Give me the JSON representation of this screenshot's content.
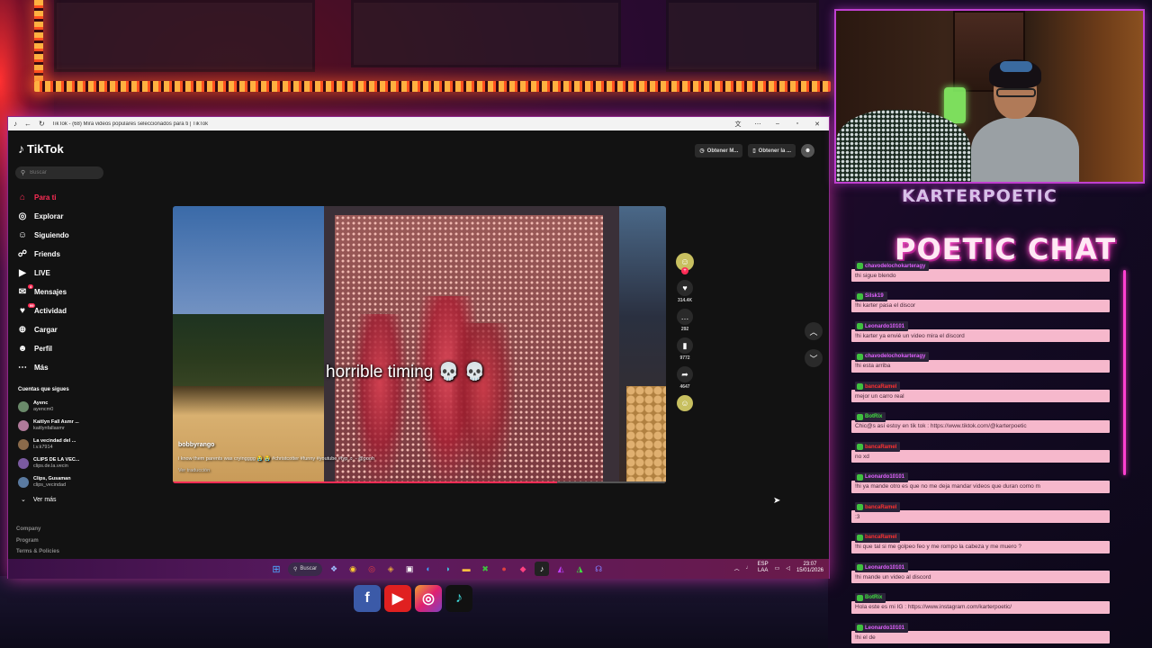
{
  "window": {
    "title": "TikTok - (68) Mira videos populares seleccionados para ti | TikTok"
  },
  "tiktok": {
    "logo": "TikTok",
    "search_placeholder": "Buscar",
    "nav": [
      {
        "label": "Para ti",
        "icon": "home-icon",
        "active": true
      },
      {
        "label": "Explorar",
        "icon": "compass-icon"
      },
      {
        "label": "Siguiendo",
        "icon": "following-icon"
      },
      {
        "label": "Friends",
        "icon": "friends-icon"
      },
      {
        "label": "LIVE",
        "icon": "live-icon"
      },
      {
        "label": "Mensajes",
        "icon": "messages-icon",
        "badge": "4"
      },
      {
        "label": "Actividad",
        "icon": "activity-icon",
        "badge": "99"
      },
      {
        "label": "Cargar",
        "icon": "upload-icon"
      },
      {
        "label": "Perfil",
        "icon": "profile-icon"
      },
      {
        "label": "Más",
        "icon": "more-icon"
      }
    ],
    "following_title": "Cuentas que sigues",
    "following": [
      {
        "name": "Ayenc",
        "handle": "ayencm0",
        "color": "#6a8a6a"
      },
      {
        "name": "Kaitlyn Fall Asmr ...",
        "handle": "kaitlynfallasmr",
        "color": "#b07a9a"
      },
      {
        "name": "La vecindad del ...",
        "handle": "l.v.k7914",
        "color": "#8a6a4a"
      },
      {
        "name": "CLIPS DE LA VEC...",
        "handle": "clips.de.la.vecin",
        "color": "#7a5aa0"
      },
      {
        "name": "Clips, Gusaman",
        "handle": "clips_vecindad",
        "color": "#5a7aa0"
      }
    ],
    "see_more": "Ver más",
    "footer": [
      "Company",
      "Program",
      "Terms & Policies"
    ],
    "top_buttons": [
      "Obtener M...",
      "Obtener la ..."
    ],
    "video": {
      "caption": "horrible timing",
      "author": "bobbyrango",
      "description": "i know them parents was cryingggg 😭 😭 #christcotter #funny #youtube #fyp ♬ - @pooh",
      "translate": "Ver traducción",
      "progress": 0.78
    },
    "actions": [
      {
        "icon": "heart-icon",
        "count": "314.4K"
      },
      {
        "icon": "comment-icon",
        "count": "292"
      },
      {
        "icon": "bookmark-icon",
        "count": "9772"
      },
      {
        "icon": "share-icon",
        "count": "4647"
      }
    ]
  },
  "taskbar": {
    "search_label": "Buscar",
    "lang_top": "ESP",
    "lang_bottom": "LAA",
    "time": "23:07",
    "date": "15/01/2026"
  },
  "stream": {
    "channel_name": "KARTERPOETIC",
    "chat_title": "POETIC CHAT"
  },
  "chat": [
    {
      "user": "chavodelochokarteragy",
      "text": "thi sigue blendo",
      "color": "#e060ff"
    },
    {
      "user": "Silsk19",
      "text": "!hi karter pasa el discor",
      "color": "#e060ff"
    },
    {
      "user": "Leonardo10101",
      "text": "!hi karter ya envié un video mira el discord",
      "color": "#e060ff"
    },
    {
      "user": "chavodelochokarteragy",
      "text": "!hi esta arriba",
      "color": "#e060ff"
    },
    {
      "user": "bancaRamel",
      "text": "mejor un carro real",
      "color": "#ff3030"
    },
    {
      "user": "BotRix",
      "text": "Chic@s así estoy en tik tok : https://www.tiktok.com/@karterpoetic",
      "color": "#40e040"
    },
    {
      "user": "bancaRamel",
      "text": "no xd",
      "color": "#ff3030"
    },
    {
      "user": "Leonardo10101",
      "text": "!hi ya mande otro es que no me deja mandar videos que duran como m",
      "color": "#e060ff"
    },
    {
      "user": "bancaRamel",
      "text": ":3",
      "color": "#ff3030"
    },
    {
      "user": "bancaRamel",
      "text": "!hi que tal si me golpeo feo y me rompo la cabeza y me muero ?",
      "color": "#ff3030"
    },
    {
      "user": "Leonardo10101",
      "text": "!hi mande un video al discord",
      "color": "#e060ff"
    },
    {
      "user": "BotRix",
      "text": "Hola este es mi IG : https://www.instagram.com/karterpoetic/",
      "color": "#40e040"
    },
    {
      "user": "Leonardo10101",
      "text": "!hi el de",
      "color": "#e060ff"
    }
  ]
}
